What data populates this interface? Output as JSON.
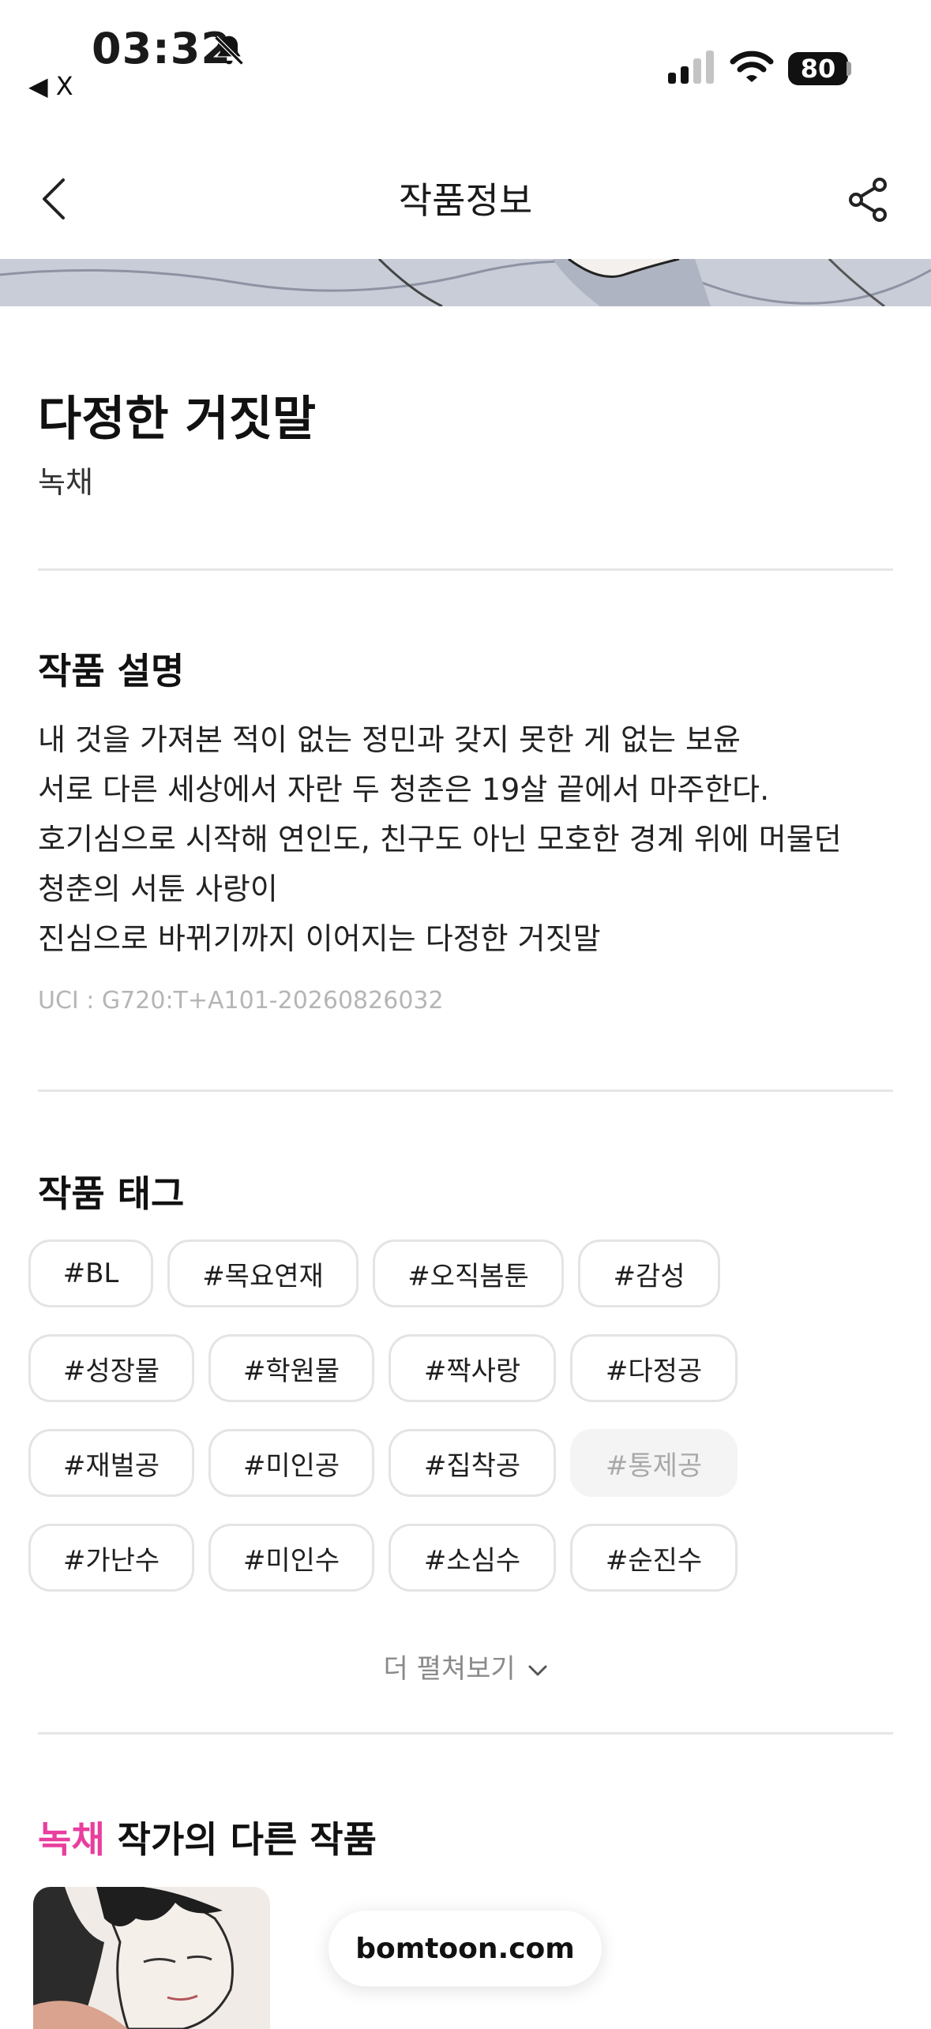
{
  "status_bar": {
    "time": "03:32",
    "back_app_label": "◀ X",
    "battery": "80"
  },
  "header": {
    "title": "작품정보"
  },
  "work": {
    "title": "다정한 거짓말",
    "author": "녹채"
  },
  "description": {
    "heading": "작품 설명",
    "lines": [
      "내 것을 가져본 적이 없는 정민과 갖지 못한 게 없는 보윤",
      "서로 다른 세상에서 자란 두 청춘은 19살 끝에서 마주한다.",
      "호기심으로 시작해 연인도, 친구도 아닌 모호한 경계 위에 머물던",
      "청춘의 서툰 사랑이",
      "진심으로 바뀌기까지 이어지는 다정한 거짓말"
    ],
    "uci": "UCI : G720:T+A101-20260826032"
  },
  "tags": {
    "heading": "작품 태그",
    "rows": [
      [
        "#BL",
        "#목요연재",
        "#오직봄툰",
        "#감성"
      ],
      [
        "#성장물",
        "#학원물",
        "#짝사랑",
        "#다정공"
      ],
      [
        "#재벌공",
        "#미인공",
        "#집착공",
        "#통제공"
      ],
      [
        "#가난수",
        "#미인수",
        "#소심수",
        "#순진수"
      ]
    ],
    "more_label": "더 펼쳐보기"
  },
  "other_works": {
    "author_name": "녹채",
    "heading_suffix": " 작가의 다른 작품"
  },
  "browser": {
    "domain": "bomtoon.com"
  },
  "colors": {
    "accent": "#e83e9e",
    "divider": "#e6e6e6",
    "tag_border": "#e4e4e4"
  }
}
